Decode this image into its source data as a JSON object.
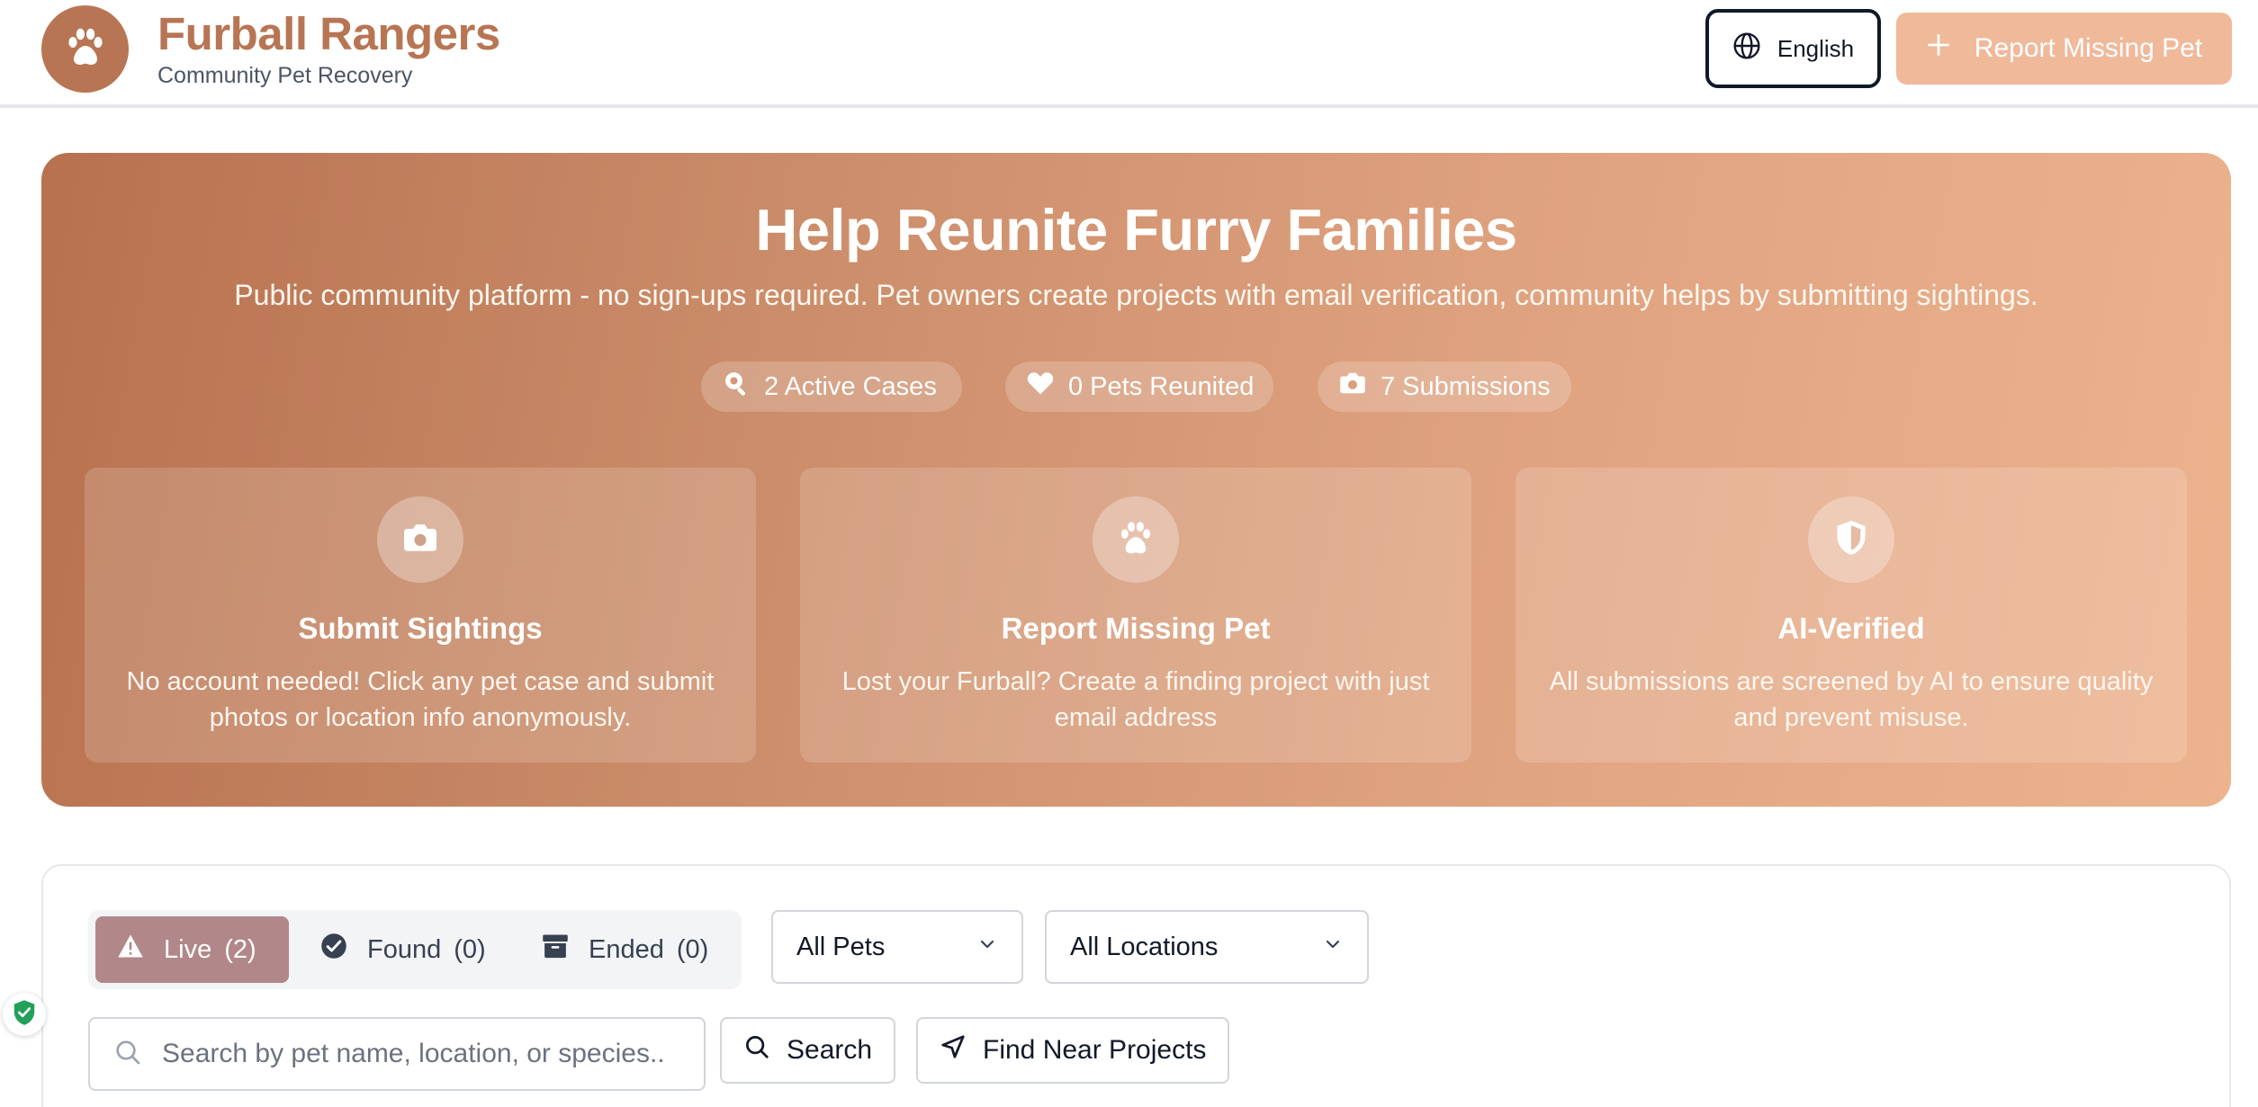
{
  "header": {
    "brand_title": "Furball Rangers",
    "brand_subtitle": "Community Pet Recovery",
    "language_label": "English",
    "report_button_label": "Report Missing Pet",
    "icons": {
      "logo": "paw-icon",
      "language": "globe-icon",
      "report": "plus-icon"
    }
  },
  "hero": {
    "title": "Help Reunite Furry Families",
    "subtitle": "Public community platform - no sign-ups required. Pet owners create projects with email verification, community helps by submitting sightings.",
    "stats": [
      {
        "label": "2 Active Cases",
        "icon": "search-icon"
      },
      {
        "label": "0 Pets Reunited",
        "icon": "heart-icon"
      },
      {
        "label": "7 Submissions",
        "icon": "camera-icon"
      }
    ],
    "features": [
      {
        "title": "Submit Sightings",
        "description": "No account needed! Click any pet case and submit photos or location info anonymously.",
        "icon": "camera-icon"
      },
      {
        "title": "Report Missing Pet",
        "description": "Lost your Furball? Create a finding project with just email address",
        "icon": "paw-icon"
      },
      {
        "title": "AI-Verified",
        "description": "All submissions are screened by AI to ensure quality and prevent misuse.",
        "icon": "shield-icon"
      }
    ]
  },
  "filters": {
    "tabs": [
      {
        "label": "Live",
        "count": "(2)",
        "icon": "warning-icon",
        "active": true
      },
      {
        "label": "Found",
        "count": "(0)",
        "icon": "check-circle-icon",
        "active": false
      },
      {
        "label": "Ended",
        "count": "(0)",
        "icon": "archive-icon",
        "active": false
      }
    ],
    "pet_select_value": "All Pets",
    "location_select_value": "All Locations",
    "search_placeholder": "Search by pet name, location, or species...",
    "search_button_label": "Search",
    "near_button_label": "Find Near Projects"
  },
  "colors": {
    "brand": "#b87554",
    "report_button": "#f0b99a",
    "active_tab": "#b2878a",
    "hero_gradient_start": "#b8714f",
    "hero_gradient_end": "#ecb38e"
  }
}
